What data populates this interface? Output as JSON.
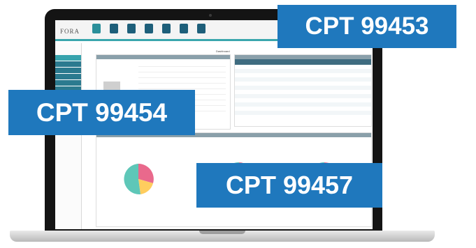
{
  "badges": [
    {
      "label": "CPT 99453"
    },
    {
      "label": "CPT 99454"
    },
    {
      "label": "CPT 99457"
    }
  ],
  "app": {
    "logo": "FORA",
    "dashboard_title": "Dashboard"
  },
  "colors": {
    "badge": "#1f78bd",
    "accent": "#3aa6ad",
    "pie": [
      "#e9698c",
      "#ffcd5e",
      "#5ec7b8"
    ]
  },
  "icons": [
    "laptop-camera-icon",
    "nav-icon",
    "pie-chart-icon"
  ]
}
